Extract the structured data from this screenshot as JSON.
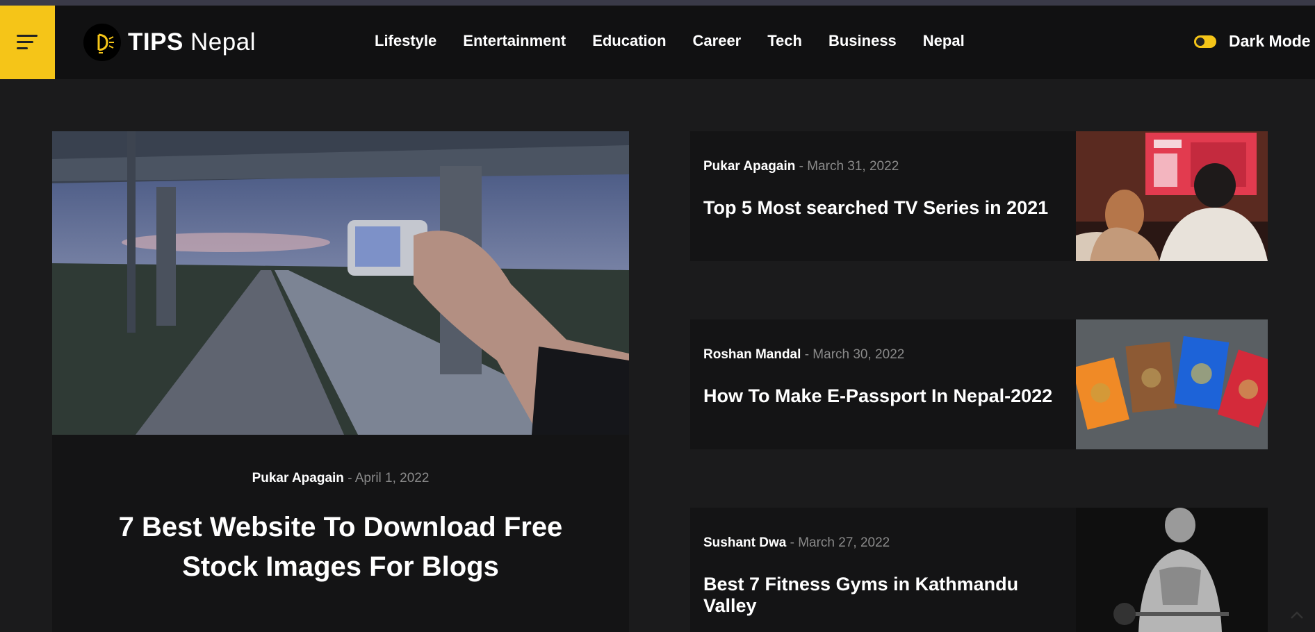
{
  "brand": {
    "name_bold": "TIPS",
    "name_light": "Nepal"
  },
  "nav": [
    "Lifestyle",
    "Entertainment",
    "Education",
    "Career",
    "Tech",
    "Business",
    "Nepal"
  ],
  "dark_mode_label": "Dark Mode",
  "colors": {
    "accent": "#f5c518",
    "background": "#1b1b1c",
    "header": "#111112",
    "card": "#141415"
  },
  "featured": {
    "author": "Pukar Apagain",
    "separator": "-",
    "date": "April 1, 2022",
    "title": "7 Best Website To Download Free Stock Images For Blogs"
  },
  "posts": [
    {
      "author": "Pukar Apagain",
      "separator": "-",
      "date": "March 31, 2022",
      "title": "Top 5 Most searched TV Series in 2021"
    },
    {
      "author": "Roshan Mandal",
      "separator": "-",
      "date": "March 30, 2022",
      "title": "How To Make E-Passport In Nepal-2022"
    },
    {
      "author": "Sushant Dwa",
      "separator": "-",
      "date": "March 27, 2022",
      "title": "Best 7 Fitness Gyms in Kathmandu Valley"
    }
  ],
  "icons": [
    "hamburger-menu-icon",
    "logo-bulb-icon",
    "dark-mode-toggle",
    "scroll-to-top-icon"
  ]
}
